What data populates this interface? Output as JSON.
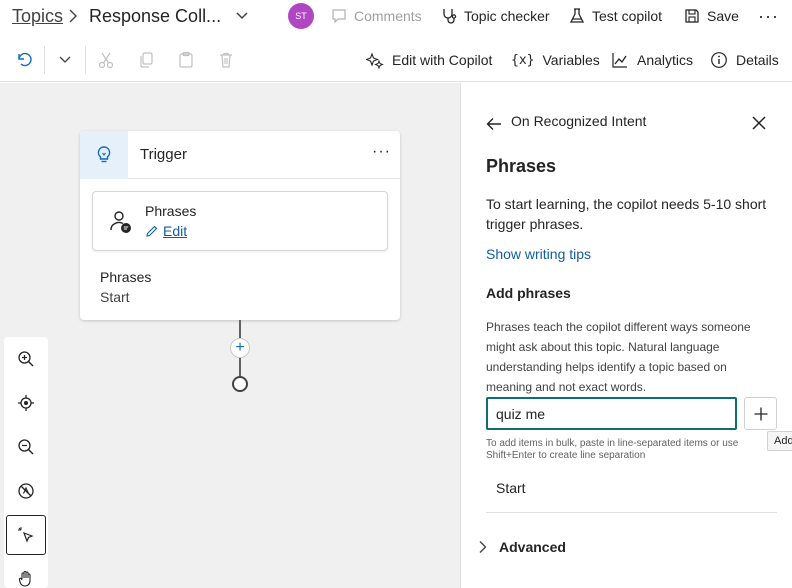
{
  "header": {
    "breadcrumb_root": "Topics",
    "topic_name": "Response Coll...",
    "avatar_initials": "ST",
    "comments_label": "Comments",
    "topic_checker_label": "Topic checker",
    "test_copilot_label": "Test copilot",
    "save_label": "Save",
    "more_label": "···",
    "avatar_color": "#b146c2"
  },
  "toolbar": {
    "edit_with_copilot": "Edit with Copilot",
    "variables": "Variables",
    "analytics": "Analytics",
    "details": "Details"
  },
  "canvas": {
    "trigger_node": {
      "title": "Trigger",
      "more_label": "···",
      "card_title": "Phrases",
      "card_edit_label": "Edit",
      "field_label": "Phrases",
      "field_value": "Start"
    },
    "add_node_symbol": "+"
  },
  "panel": {
    "header_title": "On Recognized Intent",
    "heading": "Phrases",
    "description": "To start learning, the copilot needs 5-10 short trigger phrases.",
    "tips_link": "Show writing tips",
    "add_phrases_heading": "Add phrases",
    "help_text": "Phrases teach the copilot different ways someone might ask about this topic. Natural language understanding helps identify a topic based on meaning and not exact words.",
    "input_value": "quiz me",
    "add_tooltip": "Add",
    "bulk_note": "To add items in bulk, paste in line-separated items or use Shift+Enter to create line separation",
    "phrases": [
      "Start"
    ],
    "advanced_label": "Advanced"
  },
  "colors": {
    "accent": "#0f6cbd",
    "link": "#115ea3",
    "input_border": "#0f6e6e",
    "canvas_bg": "#f0f0f0"
  }
}
